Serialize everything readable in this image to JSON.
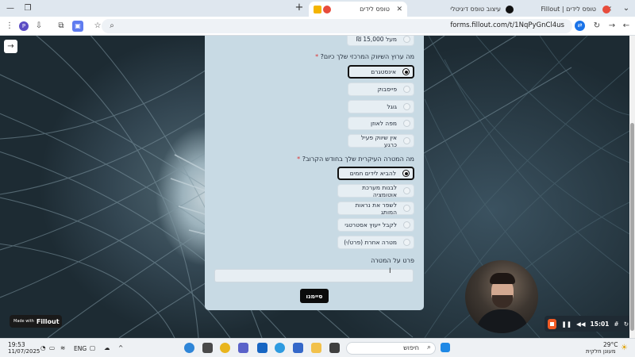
{
  "browser": {
    "tabs": [
      {
        "title": "טופס לידים",
        "active": true,
        "icon": "fillout-icon"
      },
      {
        "title": "עיצוב טופס דיגיטלי",
        "active": false,
        "icon": "chatgpt-icon"
      },
      {
        "title": "טופס לידים | Fillout",
        "active": false,
        "icon": "fillout-icon"
      }
    ],
    "url": "forms.fillout.com/t/1NqPyGnCl4us",
    "profile_initial": "P"
  },
  "form": {
    "prev_option": "מעל 15,000 ₪",
    "q1": {
      "label": "מה ערוץ השיווק המרכזי שלך כיום?",
      "required": "*",
      "options": [
        "אינסטגרם",
        "פייסבוק",
        "גוגל",
        "מפה לאוזן",
        "אין שיווק פעיל כרגע"
      ],
      "selected": "אינסטגרם"
    },
    "q2": {
      "label": "מה המטרה העיקרית שלך בחודש הקרוב?",
      "required": "*",
      "options": [
        "להביא לידים חמים",
        "לבנות מערכת אוטומציה",
        "לשפר את נראות המותג",
        "לקבל ייעוץ אסטרטגי",
        "מטרה אחרת (פרט/י)"
      ],
      "selected": "להביא לידים חמים"
    },
    "q3": {
      "label": "פרט על המטרה",
      "value": ""
    },
    "submit_label": "סיימנו"
  },
  "branding": {
    "made_with": "Made with",
    "brand": "Fillout"
  },
  "recorder": {
    "time": "15:01"
  },
  "taskbar": {
    "time": "19:53",
    "date": "11/07/2025",
    "lang": "ENG",
    "search_placeholder": "חיפוש",
    "weather_temp": "29°C",
    "weather_desc": "מעונן חלקית"
  }
}
